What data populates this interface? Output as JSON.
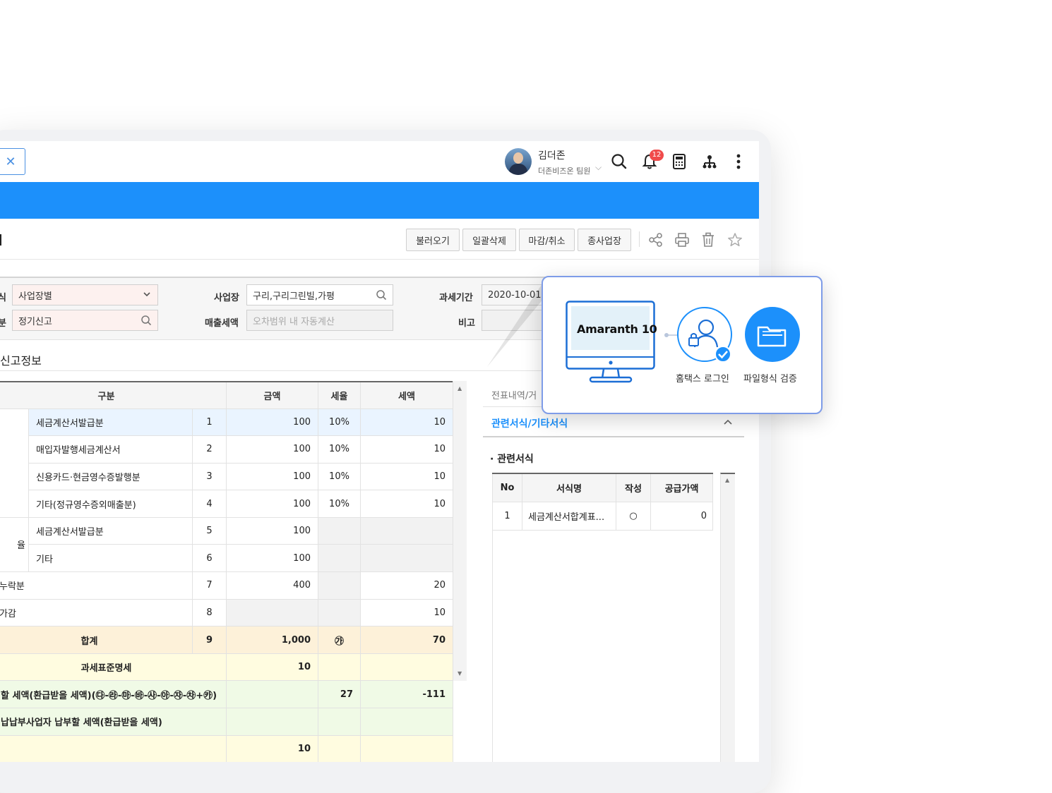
{
  "user": {
    "name": "김더존",
    "org": "더존비즈온 팀원",
    "notification_count": "12"
  },
  "header_icons": [
    "search-icon",
    "bell-icon",
    "calculator-icon",
    "org-chart-icon",
    "more-icon"
  ],
  "toolbar": {
    "btn_load": "불러오기",
    "btn_delete_all": "일괄삭제",
    "btn_close": "마감/취소",
    "btn_branch": "종사업장"
  },
  "toolbar_icons": [
    "share-icon",
    "print-icon",
    "trash-icon",
    "star-icon"
  ],
  "form": {
    "method_label": "식",
    "method_value": "사업장별",
    "type_label": "분",
    "type_value": "정기신고",
    "site_label": "사업장",
    "site_value": "구리,구리그린빌,가평",
    "sales_label": "매출세액",
    "sales_placeholder": "오차범위 내 자동계산",
    "period_label": "과세기간",
    "period_value": "2020-10-01",
    "note_label": "비고"
  },
  "section_title": "신고정보",
  "table": {
    "headers": [
      "구분",
      "",
      "금액",
      "세율",
      "세액"
    ],
    "rows": [
      {
        "left": "",
        "name": "세금계산서발급분",
        "no": "1",
        "amount": "100",
        "rate": "10%",
        "tax": "10"
      },
      {
        "left": "",
        "name": "매입자발행세금계산서",
        "no": "2",
        "amount": "100",
        "rate": "10%",
        "tax": "10"
      },
      {
        "left": "",
        "name": "신용카드·현금영수증발행분",
        "no": "3",
        "amount": "100",
        "rate": "10%",
        "tax": "10"
      },
      {
        "left": "",
        "name": "기타(정규영수증외매출분)",
        "no": "4",
        "amount": "100",
        "rate": "10%",
        "tax": "10"
      },
      {
        "left": "율",
        "name": "세금계산서발급분",
        "no": "5",
        "amount": "100",
        "rate": "",
        "tax": ""
      },
      {
        "left": "",
        "name": "기타",
        "no": "6",
        "amount": "100",
        "rate": "",
        "tax": ""
      },
      {
        "left": "누락분",
        "name": "",
        "no": "7",
        "amount": "400",
        "rate": "",
        "tax": "20"
      },
      {
        "left": "가감",
        "name": "",
        "no": "8",
        "amount": "",
        "rate": "",
        "tax": "10"
      }
    ],
    "sum": {
      "label": "합계",
      "no": "9",
      "amount": "1,000",
      "rate": "㉮",
      "tax": "70"
    },
    "standard": {
      "label": "과세표준명세",
      "value": "10"
    },
    "payable": {
      "label": "할 세액(환급받을 세액)(㉰-㉱-㉲-㉳-㉴-㉵-㉶-㉷+㉸)",
      "value1": "27",
      "value2": "-111"
    },
    "consolidated": {
      "label": "납납부사업자 납부할 세액(환급받을 세액)"
    },
    "last": {
      "value": "10"
    }
  },
  "right_panel": {
    "tab": "전표내역/거",
    "accordion": "관련서식/기타서식",
    "subtitle": "· 관련서식",
    "headers": [
      "No",
      "서식명",
      "작성",
      "공급가액"
    ],
    "rows": [
      {
        "no": "1",
        "name": "세금계산서합계표...",
        "written": "○",
        "amount": "0"
      }
    ]
  },
  "popup": {
    "brand": "Amaranth 10",
    "step1": "홈택스 로그인",
    "step2": "파일형식 검증"
  },
  "colors": {
    "accent": "#1c90fb",
    "popup_border": "#7e9ce8",
    "sum_row": "#fdf1d9",
    "required_field": "#fdf1ef"
  }
}
